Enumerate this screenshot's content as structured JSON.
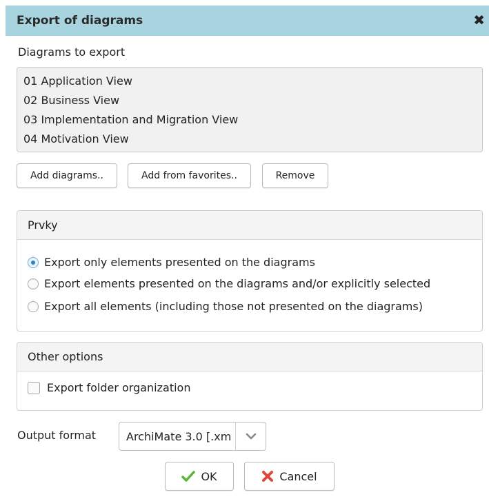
{
  "dialog": {
    "title": "Export of diagrams",
    "close_glyph": "✖"
  },
  "diagrams": {
    "label": "Diagrams to export",
    "items": [
      "01 Application View",
      "02 Business View",
      "03 Implementation and Migration View",
      "04 Motivation View"
    ],
    "buttons": {
      "add": "Add diagrams..",
      "add_favorites": "Add from favorites..",
      "remove": "Remove"
    }
  },
  "elements_panel": {
    "title": "Prvky",
    "options": [
      {
        "label": "Export only elements presented on the diagrams",
        "selected": true
      },
      {
        "label": "Export elements presented on the diagrams and/or explicitly selected",
        "selected": false
      },
      {
        "label": "Export all elements (including those not presented on the diagrams)",
        "selected": false
      }
    ]
  },
  "other_panel": {
    "title": "Other options",
    "folder_label": "Export folder organization",
    "folder_checked": false
  },
  "output": {
    "label": "Output format",
    "value": "ArchiMate 3.0 [.xm"
  },
  "actions": {
    "ok": "OK",
    "cancel": "Cancel"
  },
  "colors": {
    "title_bar": "#a8d4e0",
    "ok_icon": "#5bb33a",
    "cancel_icon": "#e0453a",
    "radio_selected": "#2f7fc1"
  },
  "icons": {
    "close": "close-icon",
    "ok": "checkmark-icon",
    "cancel": "x-icon",
    "dropdown": "chevron-down-icon"
  }
}
